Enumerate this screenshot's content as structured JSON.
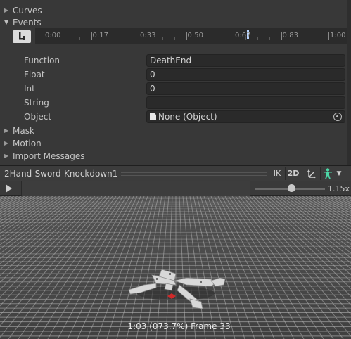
{
  "inspector": {
    "curves_label": "Curves",
    "events_label": "Events",
    "mask_label": "Mask",
    "motion_label": "Motion",
    "import_messages_label": "Import Messages",
    "timeline_ticks": [
      "0:00",
      "0:17",
      "0:33",
      "0:50",
      "0:67",
      "0:83",
      "1:00"
    ],
    "fields": {
      "function": {
        "label": "Function",
        "value": "DeathEnd"
      },
      "float": {
        "label": "Float",
        "value": "0"
      },
      "int": {
        "label": "Int",
        "value": "0"
      },
      "string": {
        "label": "String",
        "value": ""
      },
      "object": {
        "label": "Object",
        "value": "None (Object)"
      }
    }
  },
  "preview": {
    "title": "2Hand-Sword-Knockdown1",
    "ik_label": "IK",
    "twod_label": "2D",
    "speed_label": "1.15x",
    "speed_fraction": 0.52,
    "status": "1:03 (073.7%) Frame 33"
  },
  "icons": {
    "add_event": "add-event-icon",
    "pivot": "pivot-icon",
    "avatar": "avatar-icon",
    "dropdown": "dropdown-icon",
    "play": "play-icon",
    "object_picker": "object-picker-icon"
  },
  "colors": {
    "panel_bg": "#383838",
    "field_bg": "#2a2a2a",
    "avatar_green": "#4cd7a6",
    "event_marker": "#b8d4ff"
  }
}
